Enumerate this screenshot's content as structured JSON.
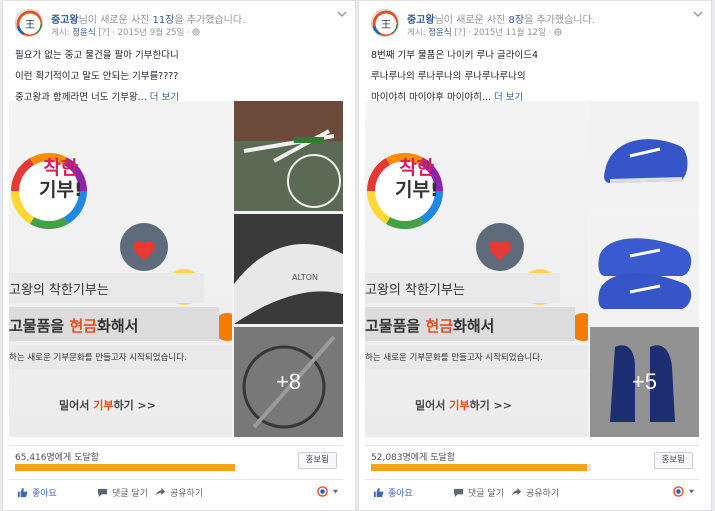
{
  "posts": [
    {
      "page_name": "중고왕",
      "header_suffix_1": "님이 새로운 사진 ",
      "photo_count": "11장",
      "header_suffix_2": "을 추가했습니다.",
      "posted_by_label": "게시:",
      "author": "정윤식",
      "meta_tail": "[?] · 2015년 9월 25일 ·",
      "lines": [
        "필요가 없는 중고 물건을 팔아 기부한다니",
        "이런 획기적이고 말도 안되는 기부를????",
        "중고왕과 함께라면 너도 기부왕..."
      ],
      "see_more": "더 보기",
      "more_photos": "+8",
      "reach_text": "65,416명에게 도달함",
      "reach_fraction": 1.0,
      "boost_label": "홍보됨",
      "like_label": "좋아요",
      "comment_label": "댓글 달기",
      "share_label": "공유하기",
      "thumb_text": "ALTON"
    },
    {
      "page_name": "중고왕",
      "header_suffix_1": "님이 새로운 사진 ",
      "photo_count": "8장",
      "header_suffix_2": "을 추가했습니다.",
      "posted_by_label": "게시:",
      "author": "정윤식",
      "meta_tail": "[?] · 2015년 11월 12일 ·",
      "lines": [
        "8번째 기부 물품은 나이키 루나 글라이드4",
        "루나루나의 루나루나의 루나루나루나의",
        "마이야히 마이야후 마이야히..."
      ],
      "see_more": "더 보기",
      "more_photos": "+5",
      "reach_text": "52,083명에게 도달함",
      "reach_fraction": 0.98,
      "boost_label": "홍보됨",
      "like_label": "좋아요",
      "comment_label": "댓글 달기",
      "share_label": "공유하기"
    }
  ],
  "banner": {
    "logo_line1": "착한",
    "logo_line2": "기부!",
    "line1": "고왕의 착한기부는",
    "line2_a": "고물품",
    "line2_b": "을 ",
    "line2_c": "현금",
    "line2_d": "화해서",
    "line3": "하는 새로운 기부문화를 만들고자 시작되었습니다.",
    "cta_a": "밀어서 ",
    "cta_b": "기부",
    "cta_c": "하기 >>"
  },
  "colors": {
    "link": "#365899",
    "reach_fill": "#f7a21e",
    "accent": "#e94e1b",
    "like_blue": "#4267b2"
  },
  "icons": [
    "chevron-down-icon",
    "thumbs-up-icon",
    "comment-icon",
    "share-arrow-icon",
    "globe-icon",
    "heart-hands-icon",
    "bicycle-icon"
  ]
}
